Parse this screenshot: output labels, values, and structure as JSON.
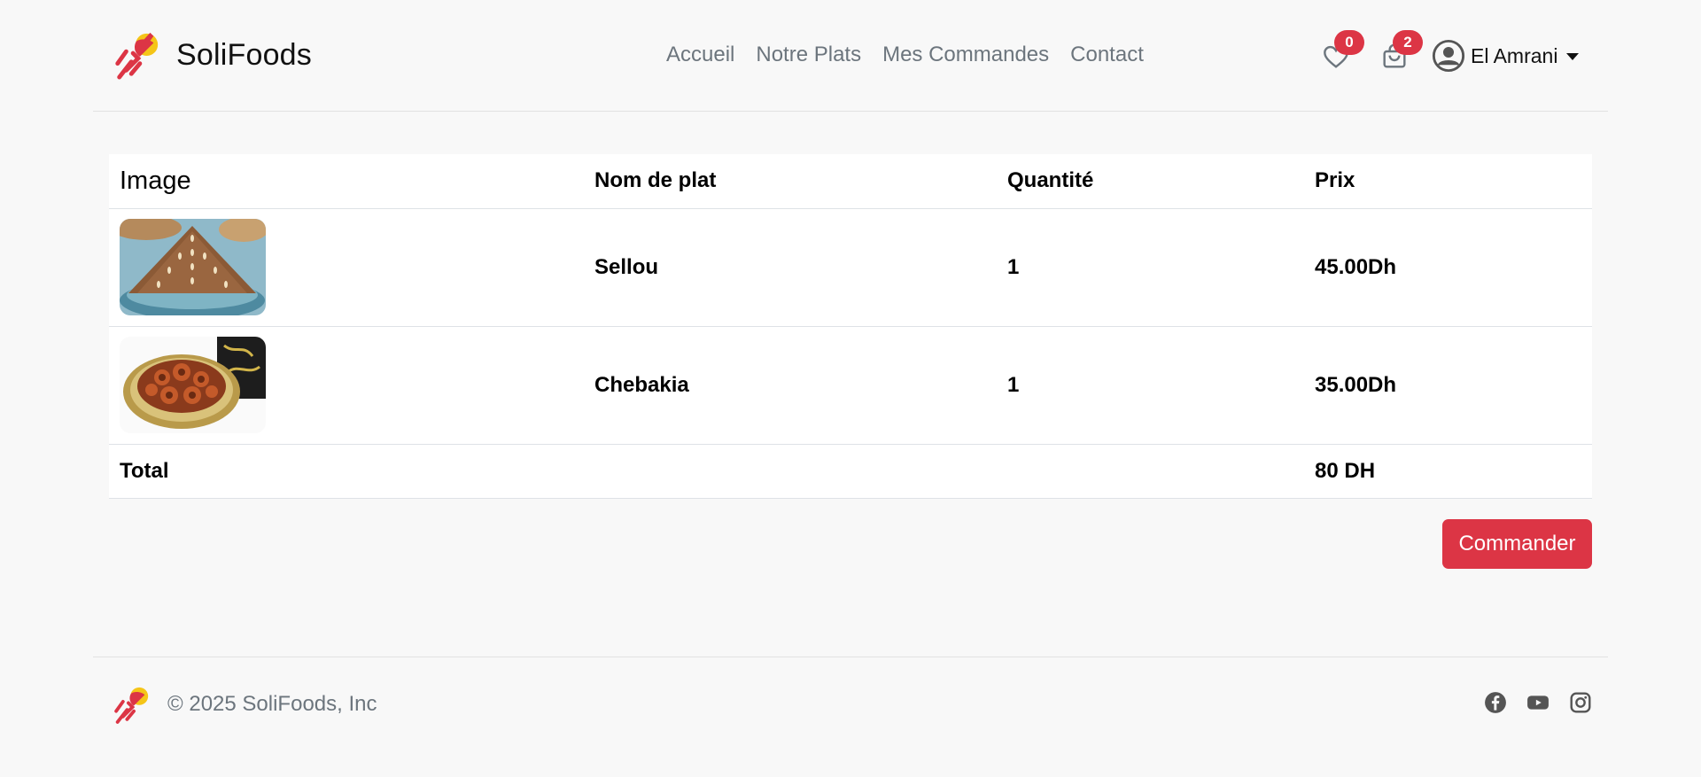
{
  "brand": {
    "name": "SoliFoods",
    "logo_icon": "rocket-food-logo"
  },
  "nav": {
    "items": [
      "Accueil",
      "Notre Plats",
      "Mes Commandes",
      "Contact"
    ]
  },
  "header": {
    "wishlist_count": "0",
    "cart_count": "2",
    "user_name": "El Amrani",
    "accent_color": "#dc3545"
  },
  "table": {
    "headers": {
      "image": "Image",
      "name": "Nom de plat",
      "quantity": "Quantité",
      "price": "Prix"
    },
    "rows": [
      {
        "image_icon": "sellou-dish-image",
        "name": "Sellou",
        "quantity": "1",
        "price": "45.00Dh"
      },
      {
        "image_icon": "chebakia-dish-image",
        "name": "Chebakia",
        "quantity": "1",
        "price": "35.00Dh"
      }
    ],
    "total_label": "Total",
    "total_value": "80 DH"
  },
  "order_button": "Commander",
  "footer": {
    "copyright": "© 2025 SoliFoods, Inc",
    "socials": [
      "facebook-icon",
      "youtube-icon",
      "instagram-icon"
    ]
  }
}
